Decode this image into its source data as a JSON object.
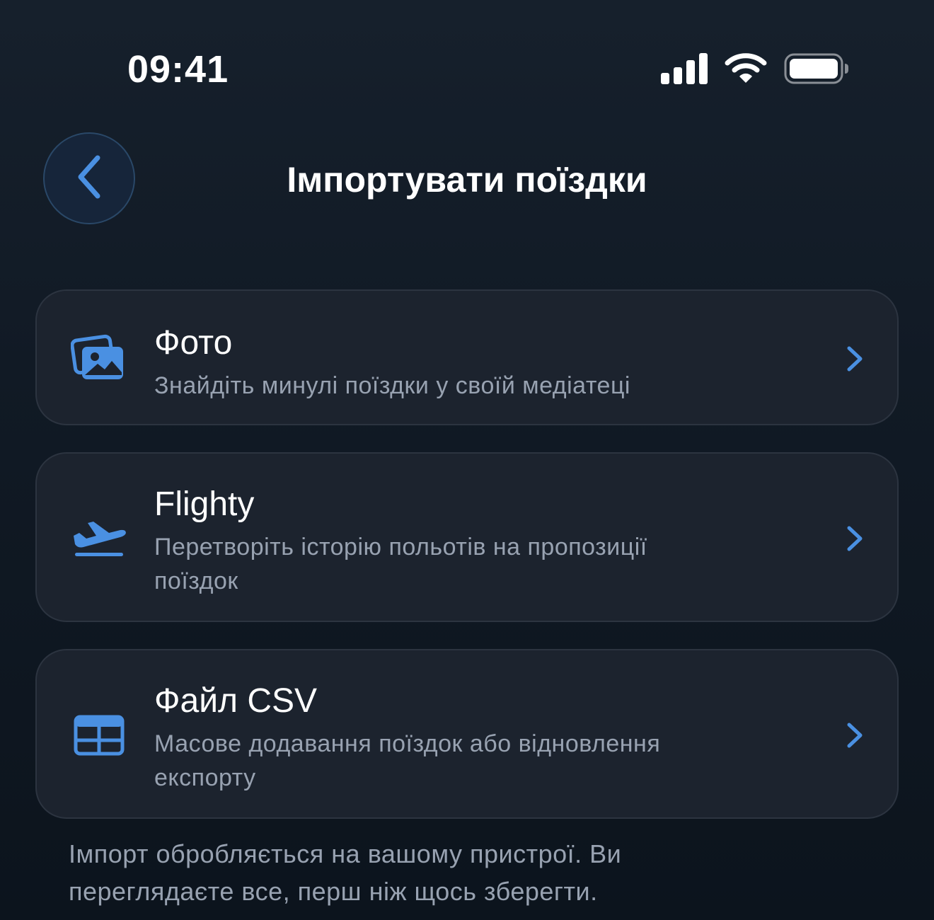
{
  "status_bar": {
    "time": "09:41",
    "icons": [
      "cellular-signal-icon",
      "wifi-icon",
      "battery-icon"
    ]
  },
  "nav": {
    "back_icon": "chevron-left-icon",
    "title": "Імпортувати поїздки"
  },
  "options": [
    {
      "icon": "photos-icon",
      "title": "Фото",
      "subtitle": "Знайдіть минулі поїздки у своїй медіатеці"
    },
    {
      "icon": "airplane-departure-icon",
      "title": "Flighty",
      "subtitle": "Перетворіть історію польотів на пропозиції поїздок"
    },
    {
      "icon": "table-icon",
      "title": "Файл CSV",
      "subtitle": "Масове додавання поїздок або відновлення експорту"
    }
  ],
  "footer": {
    "note": "Імпорт обробляється на вашому пристрої. Ви переглядаєте все, перш ніж щось зберегти."
  },
  "colors": {
    "accent": "#4a90e2",
    "background": "#111a25",
    "card": "#1c232e",
    "secondary_text": "#98a2b1"
  }
}
